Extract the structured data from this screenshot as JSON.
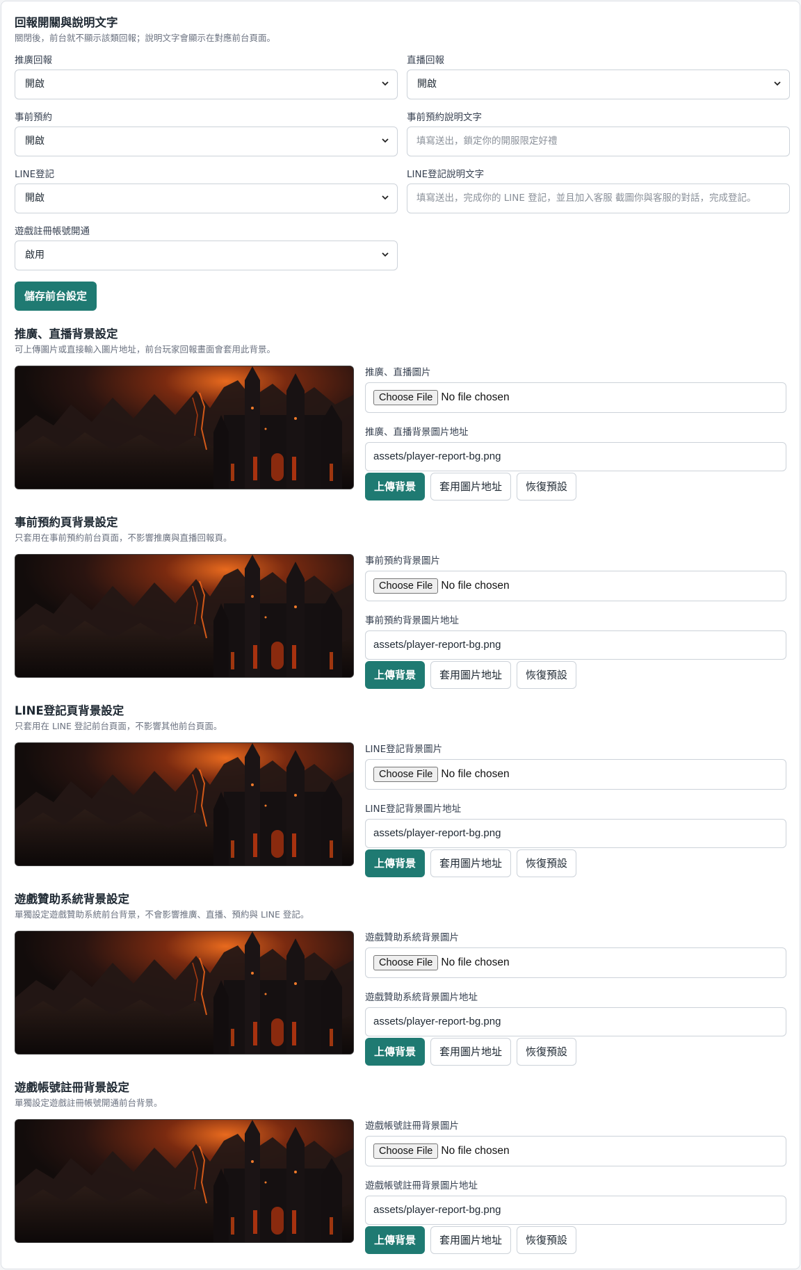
{
  "report_toggle": {
    "title": "回報開關與說明文字",
    "description": "關閉後，前台就不顯示該類回報；說明文字會顯示在對應前台頁面。",
    "promo_report": {
      "label": "推廣回報",
      "value": "開啟"
    },
    "live_report": {
      "label": "直播回報",
      "value": "開啟"
    },
    "preregister": {
      "label": "事前預約",
      "value": "開啟"
    },
    "preregister_text": {
      "label": "事前預約說明文字",
      "placeholder": "填寫送出，鎖定你的開服限定好禮"
    },
    "line_register": {
      "label": "LINE登記",
      "value": "開啟"
    },
    "line_register_text": {
      "label": "LINE登記說明文字",
      "placeholder": "填寫送出，完成你的 LINE 登記，並且加入客服 截圖你與客服的對話，完成登記。"
    },
    "game_account": {
      "label": "遊戲註冊帳號開通",
      "value": "啟用"
    },
    "save_label": "儲存前台設定"
  },
  "bg_sections": [
    {
      "title": "推廣、直播背景設定",
      "description": "可上傳圖片或直接輸入圖片地址，前台玩家回報畫面會套用此背景。",
      "file_label": "推廣、直播圖片",
      "url_label": "推廣、直播背景圖片地址"
    },
    {
      "title": "事前預約頁背景設定",
      "description": "只套用在事前預約前台頁面，不影響推廣與直播回報頁。",
      "file_label": "事前預約背景圖片",
      "url_label": "事前預約背景圖片地址"
    },
    {
      "title": "LINE登記頁背景設定",
      "description": "只套用在 LINE 登記前台頁面，不影響其他前台頁面。",
      "file_label": "LINE登記背景圖片",
      "url_label": "LINE登記背景圖片地址"
    },
    {
      "title": "遊戲贊助系統背景設定",
      "description": "單獨設定遊戲贊助系統前台背景，不會影響推廣、直播、預約與 LINE 登記。",
      "file_label": "遊戲贊助系統背景圖片",
      "url_label": "遊戲贊助系統背景圖片地址"
    },
    {
      "title": "遊戲帳號註冊背景設定",
      "description": "單獨設定遊戲註冊帳號開通前台背景。",
      "file_label": "遊戲帳號註冊背景圖片",
      "url_label": "遊戲帳號註冊背景圖片地址"
    }
  ],
  "common": {
    "choose_file": "Choose File",
    "no_file": "No file chosen",
    "url_value": "assets/player-report-bg.png",
    "upload_label": "上傳背景",
    "apply_label": "套用圖片地址",
    "reset_label": "恢復預設"
  },
  "colors": {
    "primary": "#1f7a72",
    "border": "#ccd2d9",
    "muted_text": "#6b7280"
  },
  "icons": {
    "select_arrow": "chevron-down-icon"
  }
}
